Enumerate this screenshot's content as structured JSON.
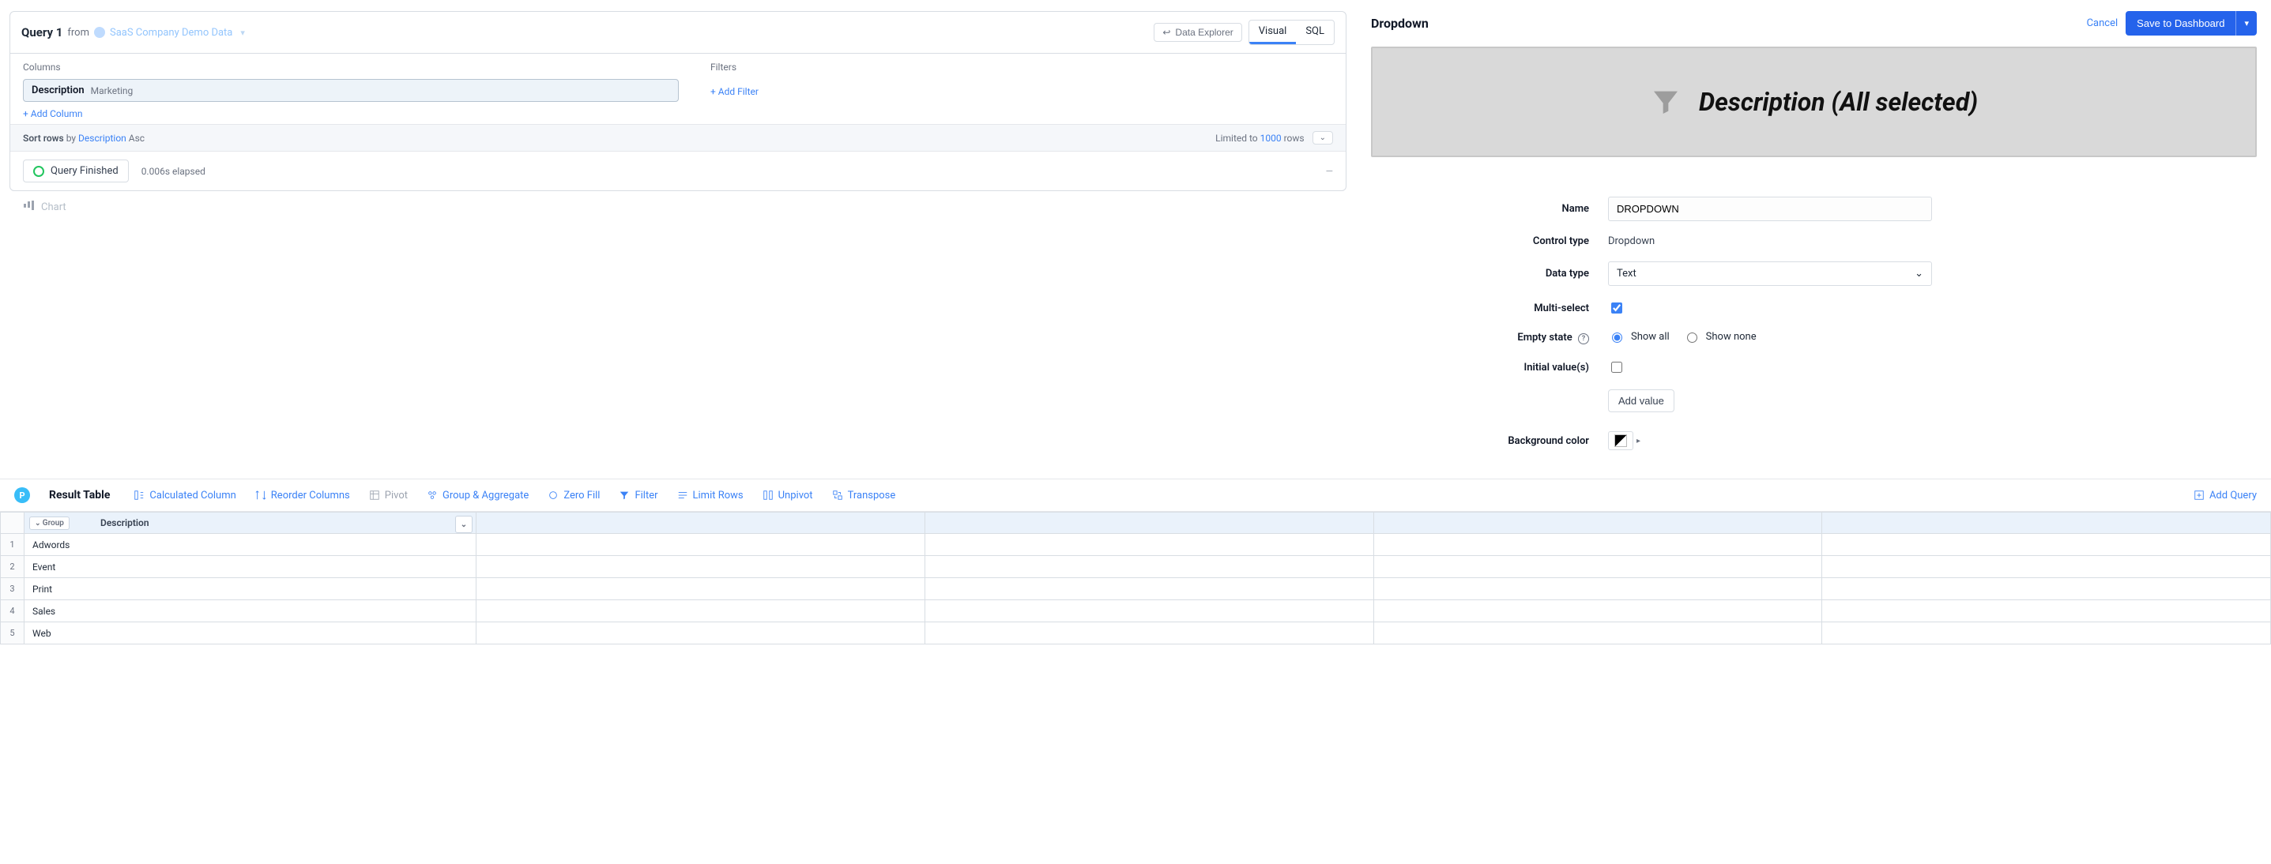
{
  "query": {
    "title": "Query 1",
    "from_label": "from",
    "datasource": "SaaS Company Demo Data",
    "data_explorer_label": "Data Explorer",
    "view_tabs": {
      "visual": "Visual",
      "sql": "SQL"
    }
  },
  "columns": {
    "section_label": "Columns",
    "pill_name": "Description",
    "pill_value": "Marketing",
    "add_label": "+ Add Column"
  },
  "filters": {
    "section_label": "Filters",
    "add_label": "+ Add Filter"
  },
  "sort": {
    "prefix": "Sort rows",
    "by": "by",
    "field": "Description",
    "dir": "Asc",
    "limit_prefix": "Limited to",
    "limit_value": "1000",
    "limit_suffix": "rows"
  },
  "status": {
    "badge": "Query Finished",
    "elapsed": "0.006s elapsed"
  },
  "chart_tab": "Chart",
  "panel": {
    "title": "Dropdown",
    "cancel": "Cancel",
    "save": "Save to Dashboard",
    "preview_text": "Description (All selected)",
    "form": {
      "name_label": "Name",
      "name_value": "DROPDOWN",
      "control_type_label": "Control type",
      "control_type_value": "Dropdown",
      "data_type_label": "Data type",
      "data_type_value": "Text",
      "multiselect_label": "Multi-select",
      "empty_state_label": "Empty state",
      "show_all": "Show all",
      "show_none": "Show none",
      "initial_label": "Initial value(s)",
      "add_value": "Add value",
      "bg_label": "Background color"
    }
  },
  "results": {
    "title": "Result Table",
    "actions": {
      "calc": "Calculated Column",
      "reorder": "Reorder Columns",
      "pivot": "Pivot",
      "group": "Group & Aggregate",
      "zerofill": "Zero Fill",
      "filter": "Filter",
      "limitrows": "Limit Rows",
      "unpivot": "Unpivot",
      "transpose": "Transpose",
      "addquery": "Add Query"
    },
    "group_tag": "Group",
    "col_header": "Description",
    "rows": [
      "Adwords",
      "Event",
      "Print",
      "Sales",
      "Web"
    ]
  }
}
